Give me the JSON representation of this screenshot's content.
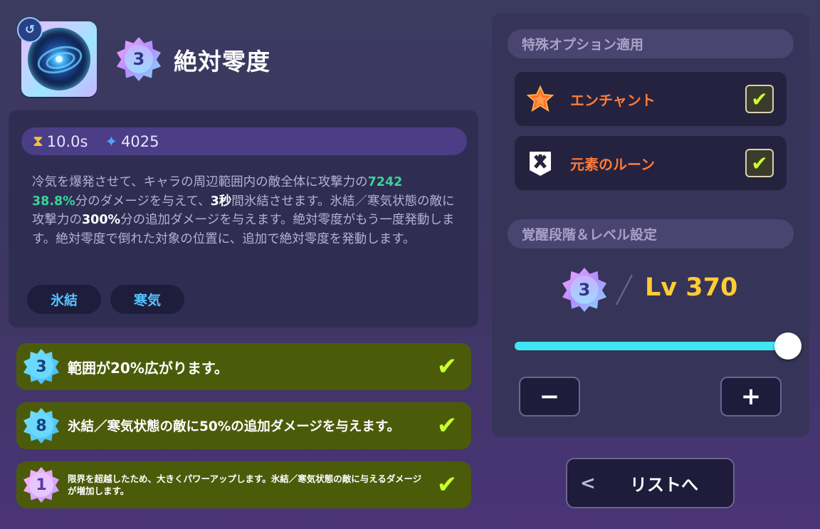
{
  "skill": {
    "name": "絶対零度",
    "grade": "3",
    "icon": "frost-vortex-icon"
  },
  "stats": {
    "cooldown": "10.0s",
    "mana": "4025",
    "cooldown_icon": "hourglass-icon",
    "mana_icon": "mana-flame-icon"
  },
  "description": {
    "seg1": "冷気を爆発させて、キャラの周辺範囲内の敵全体に攻撃力の",
    "v1": "7242",
    "v2": "38.8%",
    "seg2": "分のダメージを与えて、",
    "v3": "3秒",
    "seg3": "間氷結させます。氷結／寒気状態の敵に攻撃力の",
    "v4": "300%",
    "seg4": "分の追加ダメージを与えます。絶対零度がもう一度発動します。絶対零度で倒れた対象の位置に、追加で絶対零度を発動します。"
  },
  "tags": [
    "氷結",
    "寒気"
  ],
  "passives": [
    {
      "level": "3",
      "text": "範囲が20%広がります。",
      "checked": true
    },
    {
      "level": "8",
      "text": "氷結／寒気状態の敵に50%の追加ダメージを与えます。",
      "checked": true
    },
    {
      "level": "1",
      "text": "限界を超越したため、大きくパワーアップします。氷結／寒気状態の敵に与えるダメージが増加します。",
      "checked": true
    }
  ],
  "options": {
    "header": "特殊オプション適用",
    "items": [
      {
        "label": "エンチャント",
        "icon": "enchant-star-icon",
        "checked": true
      },
      {
        "label": "元素のルーン",
        "icon": "element-rune-icon",
        "checked": true
      }
    ]
  },
  "awakening": {
    "header": "覚醒段階＆レベル設定",
    "grade": "3",
    "level_text": "Lv 370",
    "slider_fraction": 1.0,
    "minus_label": "−",
    "plus_label": "+"
  },
  "nav": {
    "back_label": "リストへ"
  },
  "colors": {
    "accent_cyan": "#3ee6f2",
    "level_yellow": "#ffcc33",
    "option_orange": "#ff7a3a",
    "check_green": "#c8ff2e",
    "passive_bg": "#4c5b0a"
  }
}
